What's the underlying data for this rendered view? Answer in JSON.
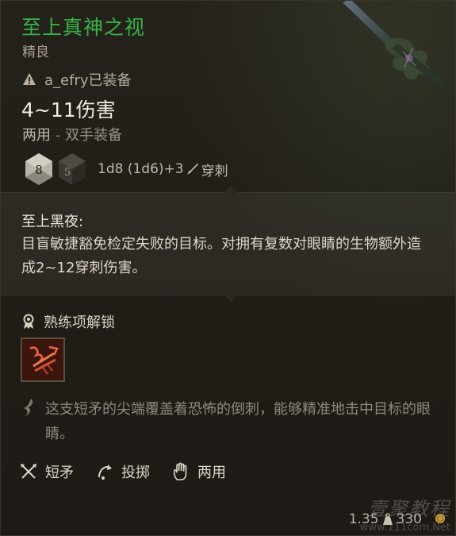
{
  "item": {
    "name": "至上真神之视",
    "rarity": "精良",
    "equipped_by": "a_efry已装备",
    "damage": "4~11伤害",
    "handedness": "两用",
    "handed_separator": " - ",
    "handed_extra": "双手装备",
    "dice": {
      "die1": "8",
      "die2": "5",
      "formula": "1d8 (1d6)+3",
      "damage_type": "穿刺"
    }
  },
  "passive": {
    "title": "至上黑夜:",
    "description": "目盲敏捷豁免检定失败的目标。对拥有复数对眼睛的生物额外造成2~12穿刺伤害。"
  },
  "proficiency": {
    "label": "熟练项解锁"
  },
  "flavor": "这支短矛的尖端覆盖着恐怖的倒刺，能够精准地击中目标的眼睛。",
  "properties": [
    {
      "label": "短矛",
      "icon": "crossed-spears-icon"
    },
    {
      "label": "投掷",
      "icon": "throw-arc-icon"
    },
    {
      "label": "两用",
      "icon": "hand-icon"
    }
  ],
  "footer": {
    "weight": "1.35",
    "value": "330"
  },
  "watermark": {
    "text": "壹聚教程",
    "url": "www.111com.Net"
  },
  "colors": {
    "name_green": "#37b34a",
    "background": "#211d17",
    "panel": "#2d2922"
  }
}
